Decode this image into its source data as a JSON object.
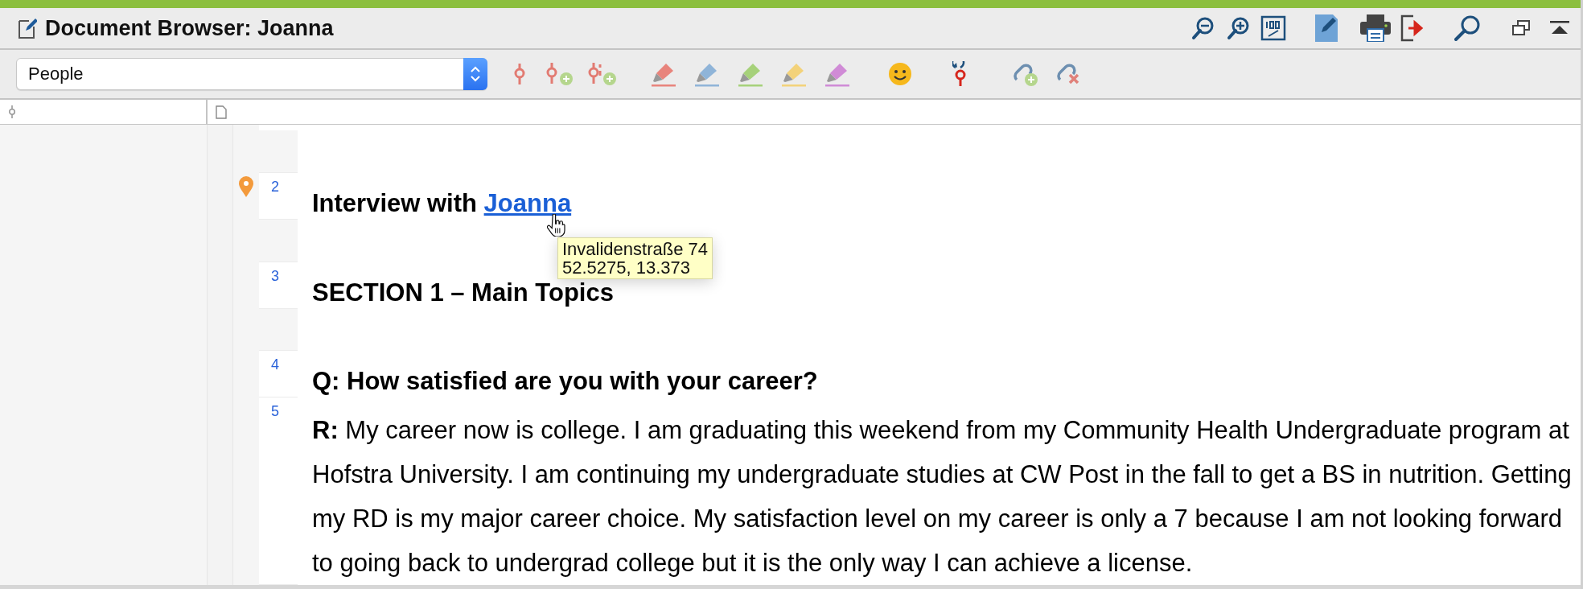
{
  "window": {
    "title": "Document Browser: Joanna"
  },
  "toolbar": {
    "code_selector": {
      "value": "People"
    },
    "highlighters": [
      {
        "color": "#e8847c"
      },
      {
        "color": "#8fb4d8"
      },
      {
        "color": "#a6d17a"
      },
      {
        "color": "#f3d27a"
      },
      {
        "color": "#d08bd6"
      }
    ]
  },
  "document": {
    "paragraphs": [
      {
        "kind": "blank"
      },
      {
        "kind": "heading",
        "number": "2",
        "geo_pin": true,
        "text": "Interview with ",
        "link": "Joanna"
      },
      {
        "kind": "blank"
      },
      {
        "kind": "heading",
        "number": "3",
        "geo_pin": false,
        "text": "SECTION 1 – Main Topics"
      },
      {
        "kind": "blank"
      },
      {
        "kind": "heading",
        "number": "4",
        "geo_pin": false,
        "text": "Q: How satisfied are you with your career?"
      },
      {
        "kind": "body",
        "number": "5",
        "geo_pin": false,
        "text": "**R:** My career now is college. I am graduating this weekend from my Community Health Undergraduate program at Hofstra University. I am continuing my undergraduate studies at CW Post in the fall to get a BS in nutrition. Getting my RD is my major career choice. My satisfaction level on my career is only a 7 because I am not looking forward to going back to undergrad college but it is the only way I can achieve a license."
      }
    ]
  },
  "tooltip": {
    "lines": [
      "Invalidenstraße 74",
      "52.5275, 13.373"
    ]
  }
}
